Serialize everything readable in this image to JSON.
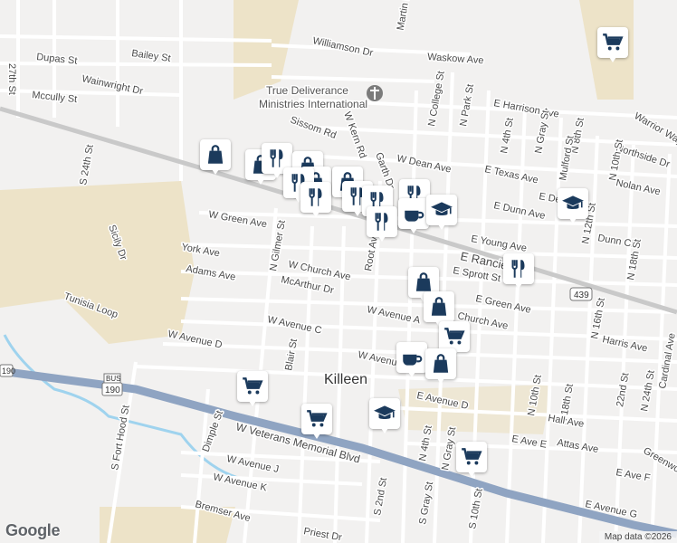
{
  "map": {
    "city_label": "Killeen",
    "attribution": "Map data ©2026",
    "logo": "Google",
    "colors": {
      "land": "#f2f1f0",
      "road": "#ffffff",
      "highway": "#8fa4c2",
      "water": "#9fd3ee",
      "park": "#ede3c8",
      "pin_icon": "#1b3a5c"
    },
    "streets": [
      "Bailey St",
      "Dupas St",
      "Wainwright Dr",
      "Mccully St",
      "27th St",
      "Williamson Dr",
      "Waskow Ave",
      "Martin Dr",
      "Sissom Rd",
      "W Kern Rd",
      "Garth Dr",
      "N College St",
      "N Park St",
      "E Harrison Ave",
      "Warrior Way",
      "N 4th St",
      "N Gray St",
      "N 8th St",
      "Northside Dr",
      "W Dean Ave",
      "E Texas Ave",
      "E Dean Ave",
      "Nolan Ave",
      "Mulford St",
      "N 10th St",
      "E Dunn Ave",
      "S 24th St",
      "Sicily Dr",
      "Tunisia Loop",
      "W Green Ave",
      "E Young Ave",
      "Dunn Cir",
      "N 12th St",
      "York Ave",
      "N Gilmer St",
      "W Church Ave",
      "Root Ave",
      "E Rancier Ave",
      "E Sprott St",
      "Adams Ave",
      "McArthur Dr",
      "E Green Ave",
      "N 16th St",
      "N 18th St",
      "W Avenue A",
      "Church Ave",
      "W Avenue C",
      "W Avenue D",
      "Blair St",
      "W Avenue B",
      "Harris Ave",
      "E Avenue D",
      "S Fort Hood St",
      "N 10th St",
      "N 12th St",
      "N 18th St",
      "22nd St",
      "N 24th St",
      "Cardinal Ave",
      "Hall Ave",
      "S 2nd St",
      "N 4th St",
      "N Gray St",
      "S 10th St",
      "W Veterans Memorial Blvd",
      "Attas Ave",
      "E Ave E",
      "Dimple St",
      "W Avenue J",
      "W Avenue K",
      "E Avenue G",
      "S Gray St",
      "Bremser Ave",
      "Priest Dr",
      "Greenwood",
      "E Ave F",
      "N 8th St"
    ],
    "shields": [
      "190",
      "190",
      "439",
      "BUS"
    ],
    "poi": {
      "name": "True Deliverance Ministries International",
      "icon": "cross-icon"
    }
  },
  "pins": [
    {
      "type": "cart"
    },
    {
      "type": "bag"
    },
    {
      "type": "bag"
    },
    {
      "type": "food"
    },
    {
      "type": "bag"
    },
    {
      "type": "bag"
    },
    {
      "type": "food"
    },
    {
      "type": "food"
    },
    {
      "type": "bag"
    },
    {
      "type": "food"
    },
    {
      "type": "food"
    },
    {
      "type": "food"
    },
    {
      "type": "food"
    },
    {
      "type": "coffee"
    },
    {
      "type": "school"
    },
    {
      "type": "school"
    },
    {
      "type": "food"
    },
    {
      "type": "bag"
    },
    {
      "type": "bag"
    },
    {
      "type": "cart"
    },
    {
      "type": "coffee"
    },
    {
      "type": "bag"
    },
    {
      "type": "cart"
    },
    {
      "type": "cart"
    },
    {
      "type": "school"
    },
    {
      "type": "cart"
    }
  ]
}
